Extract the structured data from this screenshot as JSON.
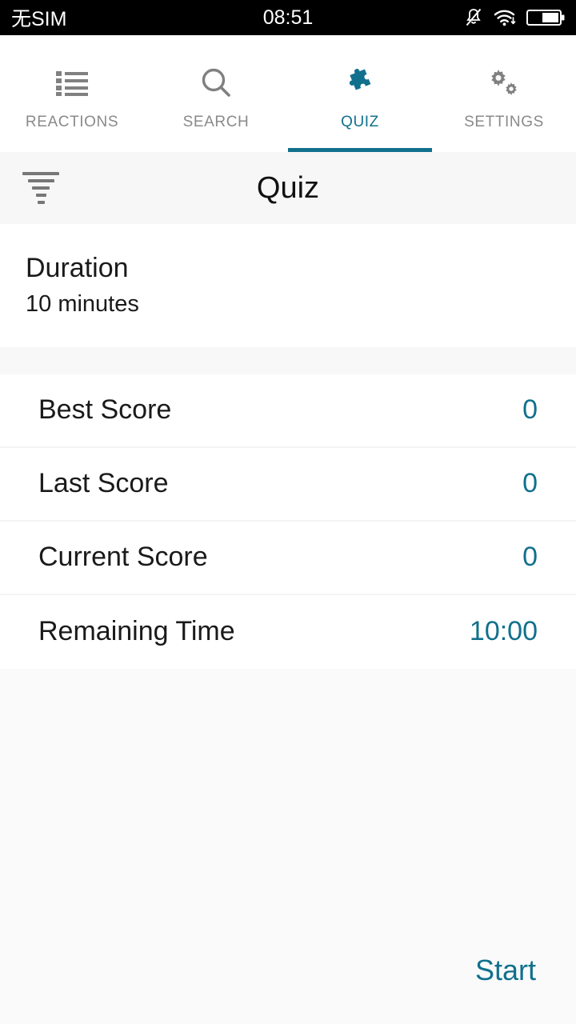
{
  "status_bar": {
    "carrier": "无SIM",
    "clock": "08:51",
    "icons": [
      "bell-muted-icon",
      "wifi-icon",
      "battery-icon"
    ]
  },
  "tabs": [
    {
      "label": "REACTIONS",
      "icon": "list-icon",
      "active": false
    },
    {
      "label": "SEARCH",
      "icon": "search-icon",
      "active": false
    },
    {
      "label": "QUIZ",
      "icon": "puzzle-icon",
      "active": true
    },
    {
      "label": "SETTINGS",
      "icon": "gears-icon",
      "active": false
    }
  ],
  "header": {
    "title": "Quiz",
    "filter_icon": "filter-funnel-icon"
  },
  "duration": {
    "label": "Duration",
    "value": "10 minutes"
  },
  "score_rows": [
    {
      "label": "Best Score",
      "value": "0"
    },
    {
      "label": "Last Score",
      "value": "0"
    },
    {
      "label": "Current Score",
      "value": "0"
    },
    {
      "label": "Remaining Time",
      "value": "10:00"
    }
  ],
  "footer": {
    "start_label": "Start"
  },
  "colors": {
    "accent": "#11708d",
    "text": "#1a1a1a",
    "muted": "#8a8a8a",
    "page_bg": "#fafafa",
    "card_bg": "#ffffff",
    "divider": "#f4f4f4",
    "statusbar_bg": "#000000"
  }
}
